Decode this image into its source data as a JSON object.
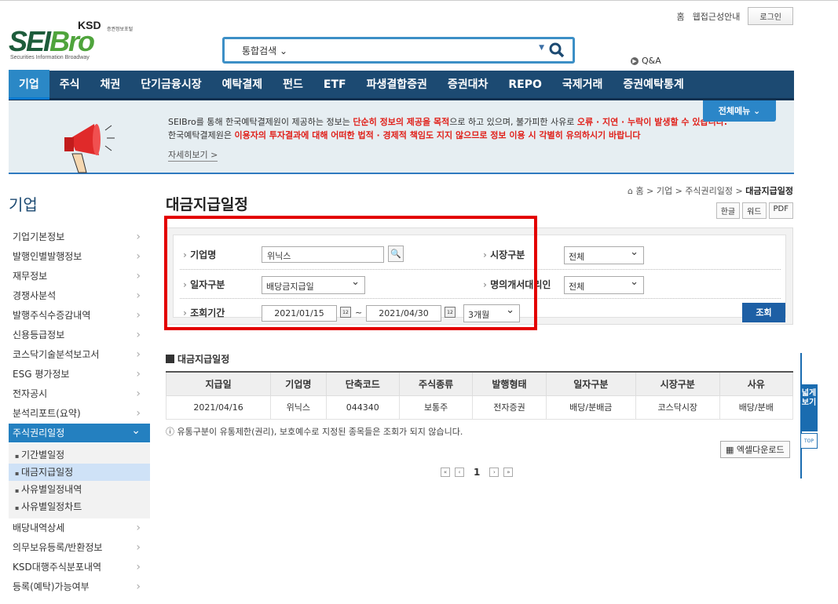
{
  "top": {
    "home": "홈",
    "accessibility": "웹접근성안내",
    "login": "로그인",
    "qna": "Q&A"
  },
  "logo": {
    "ksd": "KSD",
    "ksd_sub": "증권정보포털",
    "brand_a": "SEI",
    "brand_b": "Bro",
    "tagline": "Securities Information Broadway"
  },
  "search": {
    "category": "통합검색",
    "value": ""
  },
  "gnb": [
    "기업",
    "주식",
    "채권",
    "단기금융시장",
    "예탁결제",
    "펀드",
    "ETF",
    "파생결합증권",
    "증권대차",
    "REPO",
    "국제거래",
    "증권예탁통계"
  ],
  "notice": {
    "l1_a": "SEIBro를 통해 한국예탁결제원이 제공하는 정보는 ",
    "l1_b": "단순히 정보의 제공을 목적",
    "l1_c": "으로 하고 있으며, 불가피한 사유로 ",
    "l1_d": "오류 · 지연 · 누락이 발생할 수 있습니다.",
    "l2_a": "한국예탁결제원은 ",
    "l2_b": "이용자의 투자결과에 대해 어떠한 법적 · 경제적 책임도 지지 않으므로 정보 이용 시 각별히 유의하시기 바랍니다",
    "more": "자세히보기  >",
    "allmenu": "전체메뉴  ⌄"
  },
  "side": {
    "title": "기업",
    "items_top": [
      "기업기본정보",
      "발행인별발행정보",
      "재무정보",
      "경쟁사분석",
      "발행주식수증감내역",
      "신용등급정보",
      "코스닥기술분석보고서",
      "ESG 평가정보",
      "전자공시",
      "분석리포트(요약)"
    ],
    "active": "주식권리일정",
    "subs": [
      "기간별일정",
      "대금지급일정",
      "사유별일정내역",
      "사유별일정차트"
    ],
    "items_bottom": [
      "배당내역상세",
      "의무보유등록/반환정보",
      "KSD대행주식분포내역",
      "등록(예탁)가능여부"
    ]
  },
  "page": {
    "title": "대금지급일정",
    "crumb_home": "홈",
    "crumb_1": "기업",
    "crumb_2": "주식권리일정",
    "crumb_3": "대금지급일정",
    "btn_hwp": "한글",
    "btn_word": "워드",
    "btn_pdf": "PDF"
  },
  "form": {
    "company_label": "기업명",
    "company_value": "위닉스",
    "market_label": "시장구분",
    "market_value": "전체",
    "date_type_label": "일자구분",
    "date_type_value": "배당금지급일",
    "agent_label": "명의개서대리인",
    "agent_value": "전체",
    "period_label": "조회기간",
    "date_from": "2021/01/15",
    "tilde": "~",
    "date_to": "2021/04/30",
    "period_value": "3개월",
    "search_btn": "조회"
  },
  "result": {
    "title": "대금지급일정",
    "headers": [
      "지급일",
      "기업명",
      "단축코드",
      "주식종류",
      "발행형태",
      "일자구분",
      "시장구분",
      "사유"
    ],
    "rows": [
      [
        "2021/04/16",
        "위닉스",
        "044340",
        "보통주",
        "전자증권",
        "배당/분배금",
        "코스닥시장",
        "배당/분배"
      ]
    ],
    "note": "유통구분이 유통제한(권리), 보호예수로 지정된 종목들은 조회가 되지 않습니다.",
    "excel": "엑셀다운로드",
    "page": "1"
  },
  "float": {
    "wide": "넓게보기",
    "top": "TOP"
  }
}
